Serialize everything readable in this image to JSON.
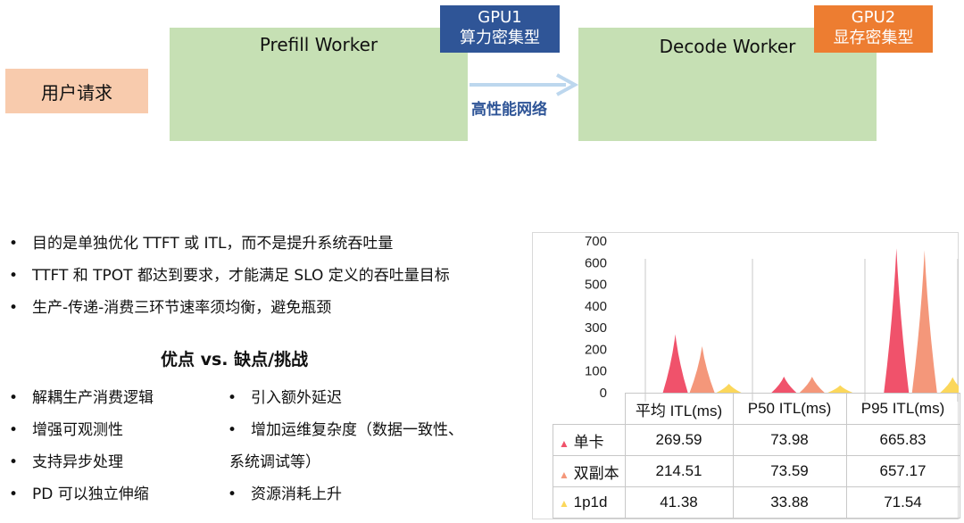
{
  "diagram": {
    "user_request": "用户请求",
    "prefill_worker": "Prefill Worker",
    "decode_worker": "Decode Worker",
    "gpu1": {
      "name": "GPU1",
      "desc": "算力密集型",
      "color": "#2f5597"
    },
    "gpu2": {
      "name": "GPU2",
      "desc": "显存密集型",
      "color": "#ed7d31"
    },
    "network": "高性能网络"
  },
  "bullets_top": [
    "目的是单独优化 TTFT 或 ITL，而不是提升系统吞吐量",
    "TTFT 和 TPOT 都达到要求，才能满足 SLO 定义的吞吐量目标",
    "生产-传递-消费三环节速率须均衡，避免瓶颈"
  ],
  "pros_cons_title": "优点 vs. 缺点/挑战",
  "pros": [
    "解耦生产消费逻辑",
    "增强可观测性",
    "支持异步处理",
    "PD 可以独立伸缩"
  ],
  "cons": [
    "引入额外延迟",
    "增加运维复杂度（数据一致性、",
    "系统调试等）",
    "资源消耗上升"
  ],
  "chart_data": {
    "type": "area",
    "categories": [
      "平均 ITL(ms)",
      "P50 ITL(ms)",
      "P95 ITL(ms)"
    ],
    "ylim": [
      0,
      700
    ],
    "yticks": [
      "700",
      "600",
      "500",
      "400",
      "300",
      "200",
      "100",
      "0"
    ],
    "series": [
      {
        "name": "单卡",
        "values": [
          269.59,
          73.98,
          665.83
        ],
        "labels": [
          "269.59",
          "73.98",
          "665.83"
        ],
        "color": "#f0526b"
      },
      {
        "name": "双副本",
        "values": [
          214.51,
          73.59,
          657.17
        ],
        "labels": [
          "214.51",
          "73.59",
          "657.17"
        ],
        "color": "#f4977a"
      },
      {
        "name": "1p1d",
        "values": [
          41.38,
          33.88,
          71.54
        ],
        "labels": [
          "41.38",
          "33.88",
          "71.54"
        ],
        "color": "#fbd75b"
      }
    ]
  }
}
